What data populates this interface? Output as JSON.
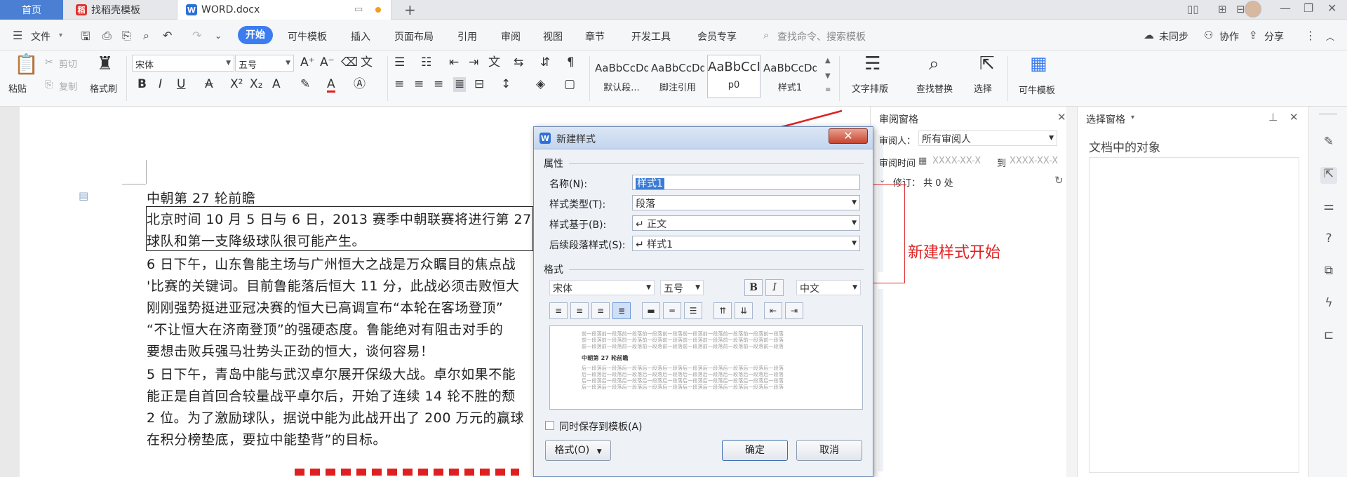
{
  "tabs": {
    "home": "首页",
    "template": "找稻壳模板",
    "doc": "WORD.docx",
    "add": "+"
  },
  "menu": {
    "file": "文件",
    "start": "开始",
    "items": [
      "可牛模板",
      "插入",
      "页面布局",
      "引用",
      "审阅",
      "视图",
      "章节",
      "开发工具",
      "会员专享"
    ],
    "search": "查找命令、搜索模板",
    "sync": "未同步",
    "collab": "协作",
    "share": "分享"
  },
  "ribbon": {
    "paste": "粘贴",
    "cut": "剪切",
    "copy": "复制",
    "format_painter": "格式刷",
    "font": "宋体",
    "size": "五号",
    "styles": [
      {
        "sample": "AaBbCcDd",
        "name": "默认段..."
      },
      {
        "sample": "AaBbCcDd",
        "name": "脚注引用"
      },
      {
        "sample": "AaBbCcI",
        "name": "p0"
      },
      {
        "sample": "AaBbCcDd",
        "name": "样式1"
      }
    ],
    "text_layout": "文字排版",
    "find_replace": "查找替换",
    "select": "选择",
    "kn_template": "可牛模板"
  },
  "document": {
    "lines": [
      "中朝第 27 轮前瞻",
      "北京时间 10 月 5 日与 6 日，2013 赛季中朝联赛将进行第 27",
      "球队和第一支降级球队很可能产生。",
      "6 日下午，山东鲁能主场与广州恒大之战是万众瞩目的焦点战",
      "'比赛的关键词。目前鲁能落后恒大 11 分，此战必须击败恒大",
      "刚刚强势挺进亚冠决赛的恒大已高调宣布“本轮在客场登顶”",
      "“不让恒大在济南登顶”的强硬态度。鲁能绝对有阻击对手的",
      "要想击败兵强马壮势头正劲的恒大，谈何容易！",
      "5 日下午，青岛中能与武汉卓尔展开保级大战。卓尔如果不能",
      "能正是自首回合较量战平卓尔后，开始了连续 14 轮不胜的颓",
      "2 位。为了激励球队，据说中能为此战开出了 200 万元的赢球",
      "在积分榜垫底，要拉中能垫背”的目标。"
    ]
  },
  "annotation": "新建样式开始",
  "review_pane": {
    "title": "审阅窗格",
    "reviewer_label": "审阅人：",
    "reviewer_value": "所有审阅人",
    "time_label": "审阅时间",
    "time_from": "XXXX-XX-X",
    "to": "到",
    "time_to": "XXXX-XX-X",
    "revisions": "修订： 共 0 处"
  },
  "select_pane": {
    "title": "选择窗格",
    "objects": "文档中的对象"
  },
  "dialog": {
    "title": "新建样式",
    "props_section": "属性",
    "name_label": "名称(N):",
    "name_value": "样式1",
    "type_label": "样式类型(T):",
    "type_value": "段落",
    "based_label": "样式基于(B):",
    "based_value": "↵ 正文",
    "next_label": "后续段落样式(S):",
    "next_value": "↵ 样式1",
    "format_section": "格式",
    "font_value": "宋体",
    "size_value": "五号",
    "bold": "B",
    "italic": "I",
    "lang_value": "中文",
    "preview_text": "前一段落前一段落前一段落前一段落前一段落前一段落前一段落前一段落前一段落前一段落",
    "preview_title": "中朝第 27 轮前瞻",
    "preview_after": "后一段落后一段落后一段落后一段落后一段落后一段落后一段落后一段落后一段落后一段落",
    "save_template": "同时保存到模板(A)",
    "format_btn": "格式(O)",
    "ok": "确定",
    "cancel": "取消"
  }
}
